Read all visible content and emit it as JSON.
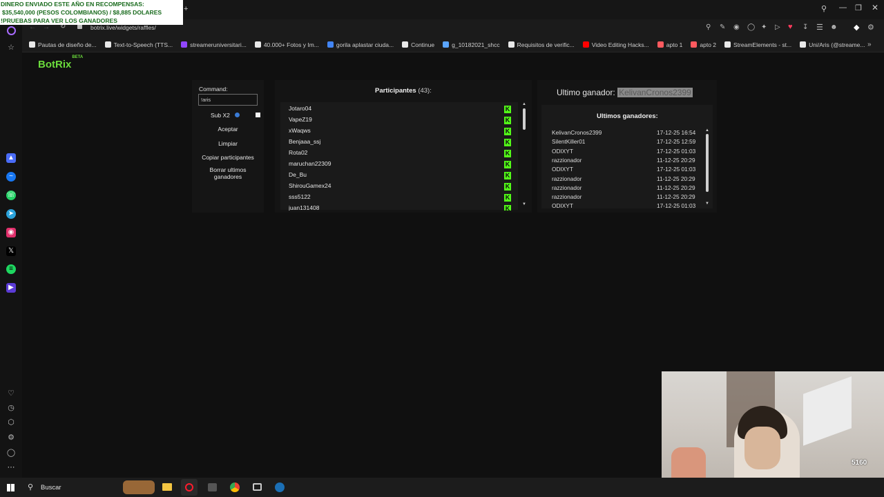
{
  "overlay": {
    "line1": "DINERO ENVIADO ESTE AÑO EN RECOMPENSAS:",
    "line2": "$35,540,000 (PESOS COLOMBIANOS) / $8,885 DOLARES",
    "line3": "!PRUEBAS PARA VER LOS GANADORES"
  },
  "browser": {
    "url": "botrix.live/widgets/raffles/",
    "bookmarks": [
      {
        "label": "Pautas de diseño de...",
        "color": "#e9e9e9"
      },
      {
        "label": "Text-to-Speech (TTS...",
        "color": "#e9e9e9"
      },
      {
        "label": "streameruniversitari...",
        "color": "#9146ff"
      },
      {
        "label": "40.000+ Fotos y Im...",
        "color": "#e9e9e9"
      },
      {
        "label": "gorila aplastar ciuda...",
        "color": "#4285f4"
      },
      {
        "label": "Continue",
        "color": "#e9e9e9"
      },
      {
        "label": "g_10182021_shcc",
        "color": "#5aa5ff"
      },
      {
        "label": "Requisitos de verific...",
        "color": "#e9e9e9"
      },
      {
        "label": "Video Editing Hacks...",
        "color": "#ff0000"
      },
      {
        "label": "apto 1",
        "color": "#ff5a5f"
      },
      {
        "label": "apto 2",
        "color": "#ff5a5f"
      },
      {
        "label": "StreamElements - st...",
        "color": "#e9e9e9"
      },
      {
        "label": "Uni/Aris (@streame...",
        "color": "#e9e9e9"
      }
    ]
  },
  "app": {
    "logo": "BotRix",
    "logo_badge": "BETA",
    "command_label": "Command:",
    "command_value": "!aris",
    "sub_label": "Sub X2",
    "buttons": {
      "accept": "Aceptar",
      "clear": "Limpiar",
      "copy": "Copiar participantes",
      "delete_line1": "Borrar ultimos",
      "delete_line2": "ganadores"
    },
    "participants_label": "Participantes",
    "participants_count": "(43):",
    "participants": [
      "Jotaro04",
      "VapeZ19",
      "xWaqws",
      "Benjaaa_ssj",
      "Rota02",
      "maruchan22309",
      "De_Bu",
      "ShirouGamex24",
      "sss5122",
      "juan131408"
    ],
    "last_winner_label": "Ultimo ganador:",
    "last_winner_name": "KelivanCronos2399",
    "winners_title": "Ultimos ganadores:",
    "winners": [
      {
        "name": "KelivanCronos2399",
        "date": "17-12-25 16:54"
      },
      {
        "name": "SilentKiller01",
        "date": "17-12-25 12:59"
      },
      {
        "name": "ODIXYT",
        "date": "17-12-25 01:03"
      },
      {
        "name": "razzionador",
        "date": "11-12-25 20:29"
      },
      {
        "name": "ODIXYT",
        "date": "17-12-25 01:03"
      },
      {
        "name": "razzionador",
        "date": "11-12-25 20:29"
      },
      {
        "name": "razzionador",
        "date": "11-12-25 20:29"
      },
      {
        "name": "razzionador",
        "date": "11-12-25 20:29"
      },
      {
        "name": "ODIXYT",
        "date": "17-12-25 01:03"
      }
    ]
  },
  "taskbar": {
    "search_placeholder": "Buscar"
  },
  "webcam": {
    "badge": "5160"
  }
}
